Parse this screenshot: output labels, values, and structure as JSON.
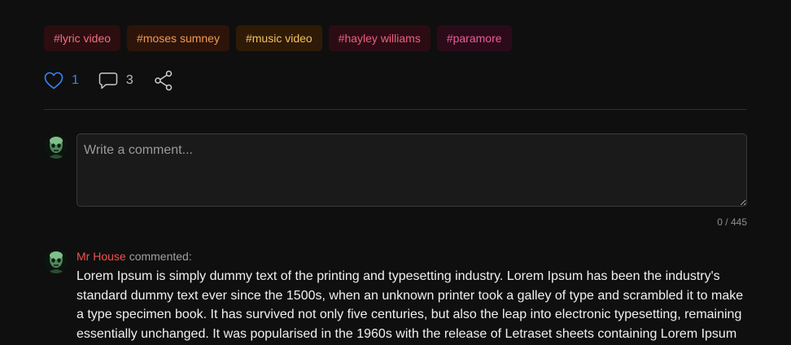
{
  "header": {
    "partial_text": "· · · · · ·"
  },
  "tags": [
    {
      "label": "#lyric video",
      "bg": "#2c0d10",
      "color": "#f0707c"
    },
    {
      "label": "#moses sumney",
      "bg": "#2d140a",
      "color": "#f29a52"
    },
    {
      "label": "#music video",
      "bg": "#2e1a07",
      "color": "#f4c05c"
    },
    {
      "label": "#hayley williams",
      "bg": "#2c0c14",
      "color": "#ef5d81"
    },
    {
      "label": "#paramore",
      "bg": "#2b0b19",
      "color": "#ec5c9a"
    }
  ],
  "actions": {
    "like_count": "1",
    "comment_count": "3",
    "like_icon": "heart-icon",
    "comment_icon": "speech-bubble-icon",
    "share_icon": "share-icon",
    "like_color": "#3b82f6"
  },
  "comment_form": {
    "placeholder": "Write a comment...",
    "counter": "0 / 445"
  },
  "comments": [
    {
      "author": "Mr House",
      "action_label": "commented:",
      "text": "Lorem Ipsum is simply dummy text of the printing and typesetting industry. Lorem Ipsum has been the industry's standard dummy text ever since the 1500s, when an unknown printer took a galley of type and scrambled it to make a type specimen book. It has survived not only five centuries, but also the leap into electronic typesetting, remaining essentially unchanged. It was popularised in the 1960s with the release of Letraset sheets containing Lorem Ipsum"
    }
  ],
  "colors": {
    "background": "#0f0f0f",
    "author": "#ef5350"
  }
}
